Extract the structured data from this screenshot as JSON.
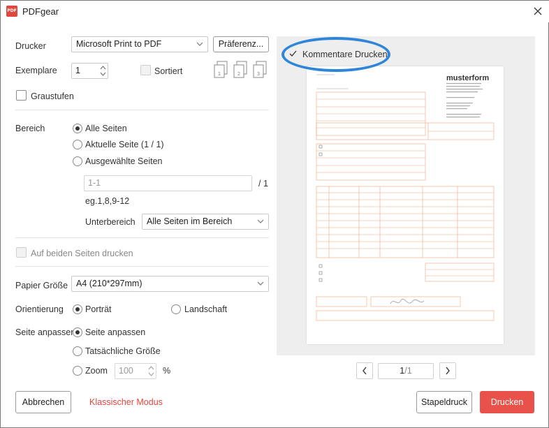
{
  "window": {
    "title": "PDFgear",
    "logo_text": "PDF"
  },
  "printer": {
    "label": "Drucker",
    "value": "Microsoft Print to PDF",
    "preferences_label": "Präferenz..."
  },
  "copies": {
    "label": "Exemplare",
    "value": "1",
    "collate_label": "Sortiert"
  },
  "grayscale": {
    "label": "Graustufen"
  },
  "range": {
    "label": "Bereich",
    "options": [
      "Alle Seiten",
      "Aktuelle Seite (1 / 1)",
      "Ausgewählte Seiten"
    ],
    "pages_placeholder": "1-1",
    "pages_total": "/ 1",
    "hint": "eg.1,8,9-12",
    "subrange_label": "Unterbereich",
    "subrange_value": "Alle Seiten im Bereich"
  },
  "duplex": {
    "label": "Auf beiden Seiten drucken"
  },
  "paper": {
    "label": "Papier Größe",
    "value": "A4 (210*297mm)"
  },
  "orientation": {
    "label": "Orientierung",
    "portrait": "Porträt",
    "landscape": "Landschaft"
  },
  "fit": {
    "label": "Seite anpassen",
    "options": [
      "Seite anpassen",
      "Tatsächliche Größe",
      "Zoom"
    ],
    "zoom_value": "100",
    "zoom_unit": "%"
  },
  "preview": {
    "comments_label": "Kommentare Drucken",
    "doc_brand": "musterform",
    "page_current": "1",
    "page_total": "/1"
  },
  "footer": {
    "cancel_label": "Abbrechen",
    "classic_mode_label": "Klassischer Modus",
    "batch_label": "Stapeldruck",
    "print_label": "Drucken"
  },
  "colors": {
    "accent": "#e9524a",
    "highlight": "#2f86d8",
    "form_lines": "#f0a37a"
  }
}
